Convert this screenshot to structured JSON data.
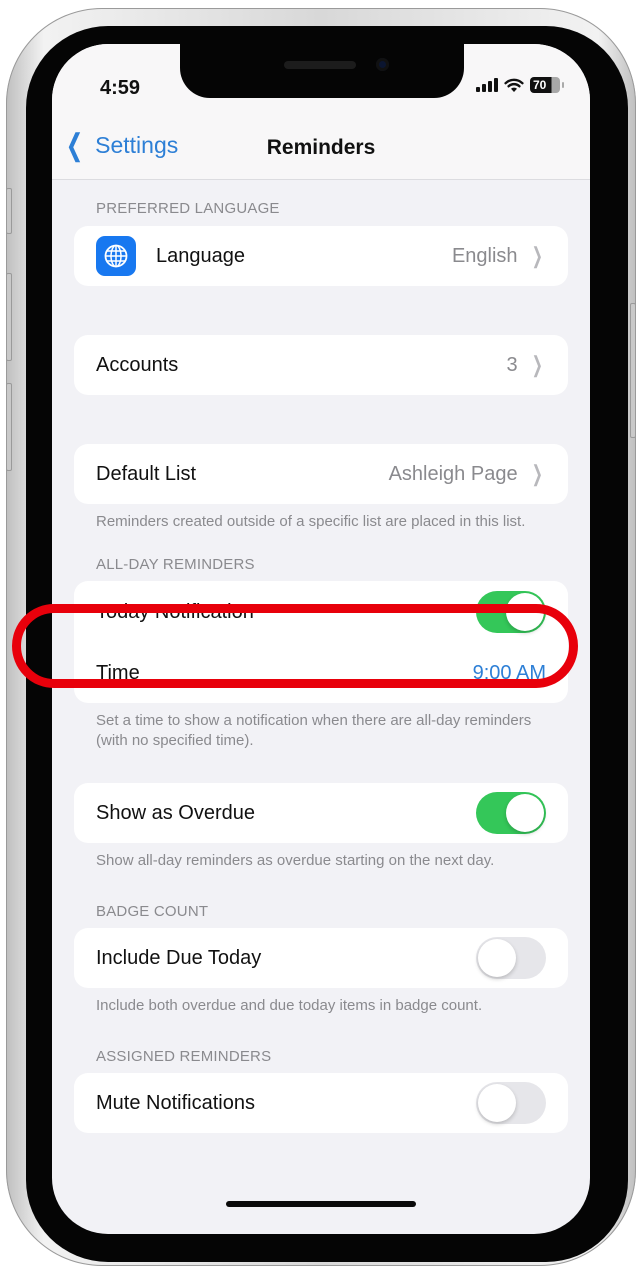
{
  "status_bar": {
    "time": "4:59",
    "battery_percent": "70",
    "signal_icon": "cellular-signal-icon",
    "wifi_icon": "wifi-icon",
    "battery_icon": "battery-icon"
  },
  "nav": {
    "back_label": "Settings",
    "back_icon": "chevron-left-icon",
    "title": "Reminders"
  },
  "sections": {
    "preferred_language": {
      "header": "PREFERRED LANGUAGE",
      "rows": [
        {
          "label": "Language",
          "value": "English",
          "icon": "globe-icon"
        }
      ]
    },
    "accounts": {
      "rows": [
        {
          "label": "Accounts",
          "value": "3"
        }
      ]
    },
    "default_list": {
      "rows": [
        {
          "label": "Default List",
          "value": "Ashleigh Page"
        }
      ],
      "footer": "Reminders created outside of a specific list are placed in this list."
    },
    "all_day": {
      "header": "ALL-DAY REMINDERS",
      "rows": [
        {
          "label": "Today Notification",
          "toggle": true
        },
        {
          "label": "Time",
          "value": "9:00 AM"
        }
      ],
      "footer": "Set a time to show a notification when there are all-day reminders (with no specified time)."
    },
    "overdue": {
      "rows": [
        {
          "label": "Show as Overdue",
          "toggle": true
        }
      ],
      "footer": "Show all-day reminders as overdue starting on the next day."
    },
    "badge_count": {
      "header": "BADGE COUNT",
      "rows": [
        {
          "label": "Include Due Today",
          "toggle": false
        }
      ],
      "footer": "Include both overdue and due today items in badge count."
    },
    "assigned": {
      "header": "ASSIGNED REMINDERS",
      "rows": [
        {
          "label": "Mute Notifications",
          "toggle": false
        }
      ]
    }
  },
  "annotation": {
    "highlight_target": "Today Notification",
    "highlight_color": "#e8000b"
  },
  "colors": {
    "accent_blue": "#2d7fd6",
    "toggle_on": "#34c759",
    "toggle_off": "#e6e6ea",
    "background": "#f2f2f6"
  }
}
